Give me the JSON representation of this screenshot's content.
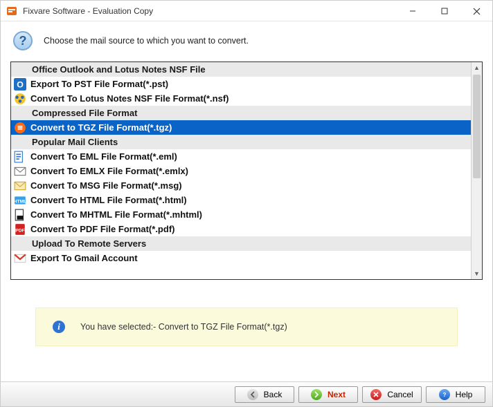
{
  "window": {
    "title": "Fixvare Software - Evaluation Copy"
  },
  "header": {
    "instruction": "Choose the mail source to which you want to convert."
  },
  "list": {
    "groups": [
      {
        "label": "Office Outlook and Lotus Notes NSF File"
      },
      {
        "label": "Compressed File Format"
      },
      {
        "label": "Popular Mail Clients"
      },
      {
        "label": "Upload To Remote Servers"
      }
    ],
    "items": {
      "pst": {
        "label": "Export To PST File Format(*.pst)"
      },
      "nsf": {
        "label": "Convert To Lotus Notes NSF File Format(*.nsf)"
      },
      "tgz": {
        "label": "Convert to TGZ File Format(*.tgz)"
      },
      "eml": {
        "label": "Convert To EML File Format(*.eml)"
      },
      "emlx": {
        "label": "Convert To EMLX File Format(*.emlx)"
      },
      "msg": {
        "label": "Convert To MSG File Format(*.msg)"
      },
      "html": {
        "label": "Convert To HTML File Format(*.html)"
      },
      "mhtml": {
        "label": "Convert To MHTML File Format(*.mhtml)"
      },
      "pdf": {
        "label": "Convert To PDF File Format(*.pdf)"
      },
      "gmail": {
        "label": "Export To Gmail Account"
      }
    }
  },
  "info": {
    "text": "You have selected:- Convert to TGZ File Format(*.tgz)"
  },
  "footer": {
    "back": "Back",
    "next": "Next",
    "cancel": "Cancel",
    "help": "Help"
  }
}
